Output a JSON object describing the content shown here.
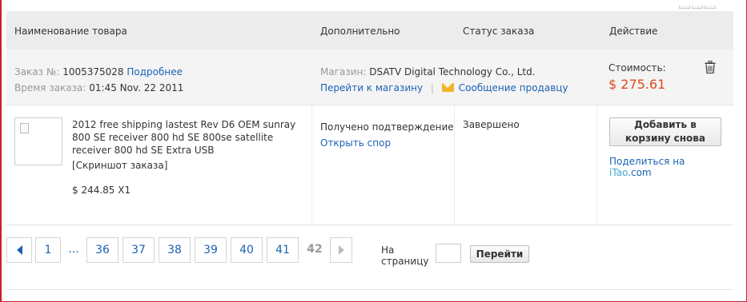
{
  "header": {
    "col_product": "Наименование товара",
    "col_extra": "Дополнительно",
    "col_status": "Статус заказа",
    "col_action": "Действие"
  },
  "order": {
    "order_no_label": "Заказ №:",
    "order_no": "1005375028",
    "details_link": "Подробнее",
    "time_label": "Время заказа:",
    "time_value": "01:45 Nov. 22 2011",
    "store_label": "Магазин:",
    "store_name": "DSATV Digital Technology Co., Ltd.",
    "go_store_link": "Перейти к магазину",
    "separator": "|",
    "message_link": "Сообщение продавцу",
    "cost_label": "Стоимость:",
    "cost_value": "$ 275.61",
    "delete_icon": "trash-icon",
    "mail_icon": "envelope-icon"
  },
  "item": {
    "title": "2012 free shipping lastest Rev D6 OEM sunray 800 SE receiver 800 hd SE 800se satellite receiver 800 hd SE Extra USB",
    "snapshot": "[Скриншот заказа]",
    "price": "$ 244.85 X1",
    "status_confirm": "Получено подтверждение",
    "dispute_link": "Открыть спор",
    "order_status": "Завершено",
    "add_to_cart": "Добавить в корзину снова",
    "share_prefix": "Поделиться на ",
    "share_site": "iTao",
    "share_suffix": ".com"
  },
  "pagination": {
    "pages": [
      "1",
      "...",
      "36",
      "37",
      "38",
      "39",
      "40",
      "41",
      "42"
    ],
    "current": "42",
    "goto_label": "На страницу",
    "goto_value": "",
    "goto_button": "Перейти"
  },
  "colors": {
    "link": "#1b62b4",
    "price": "#e0461d",
    "frame": "#c8202a"
  }
}
